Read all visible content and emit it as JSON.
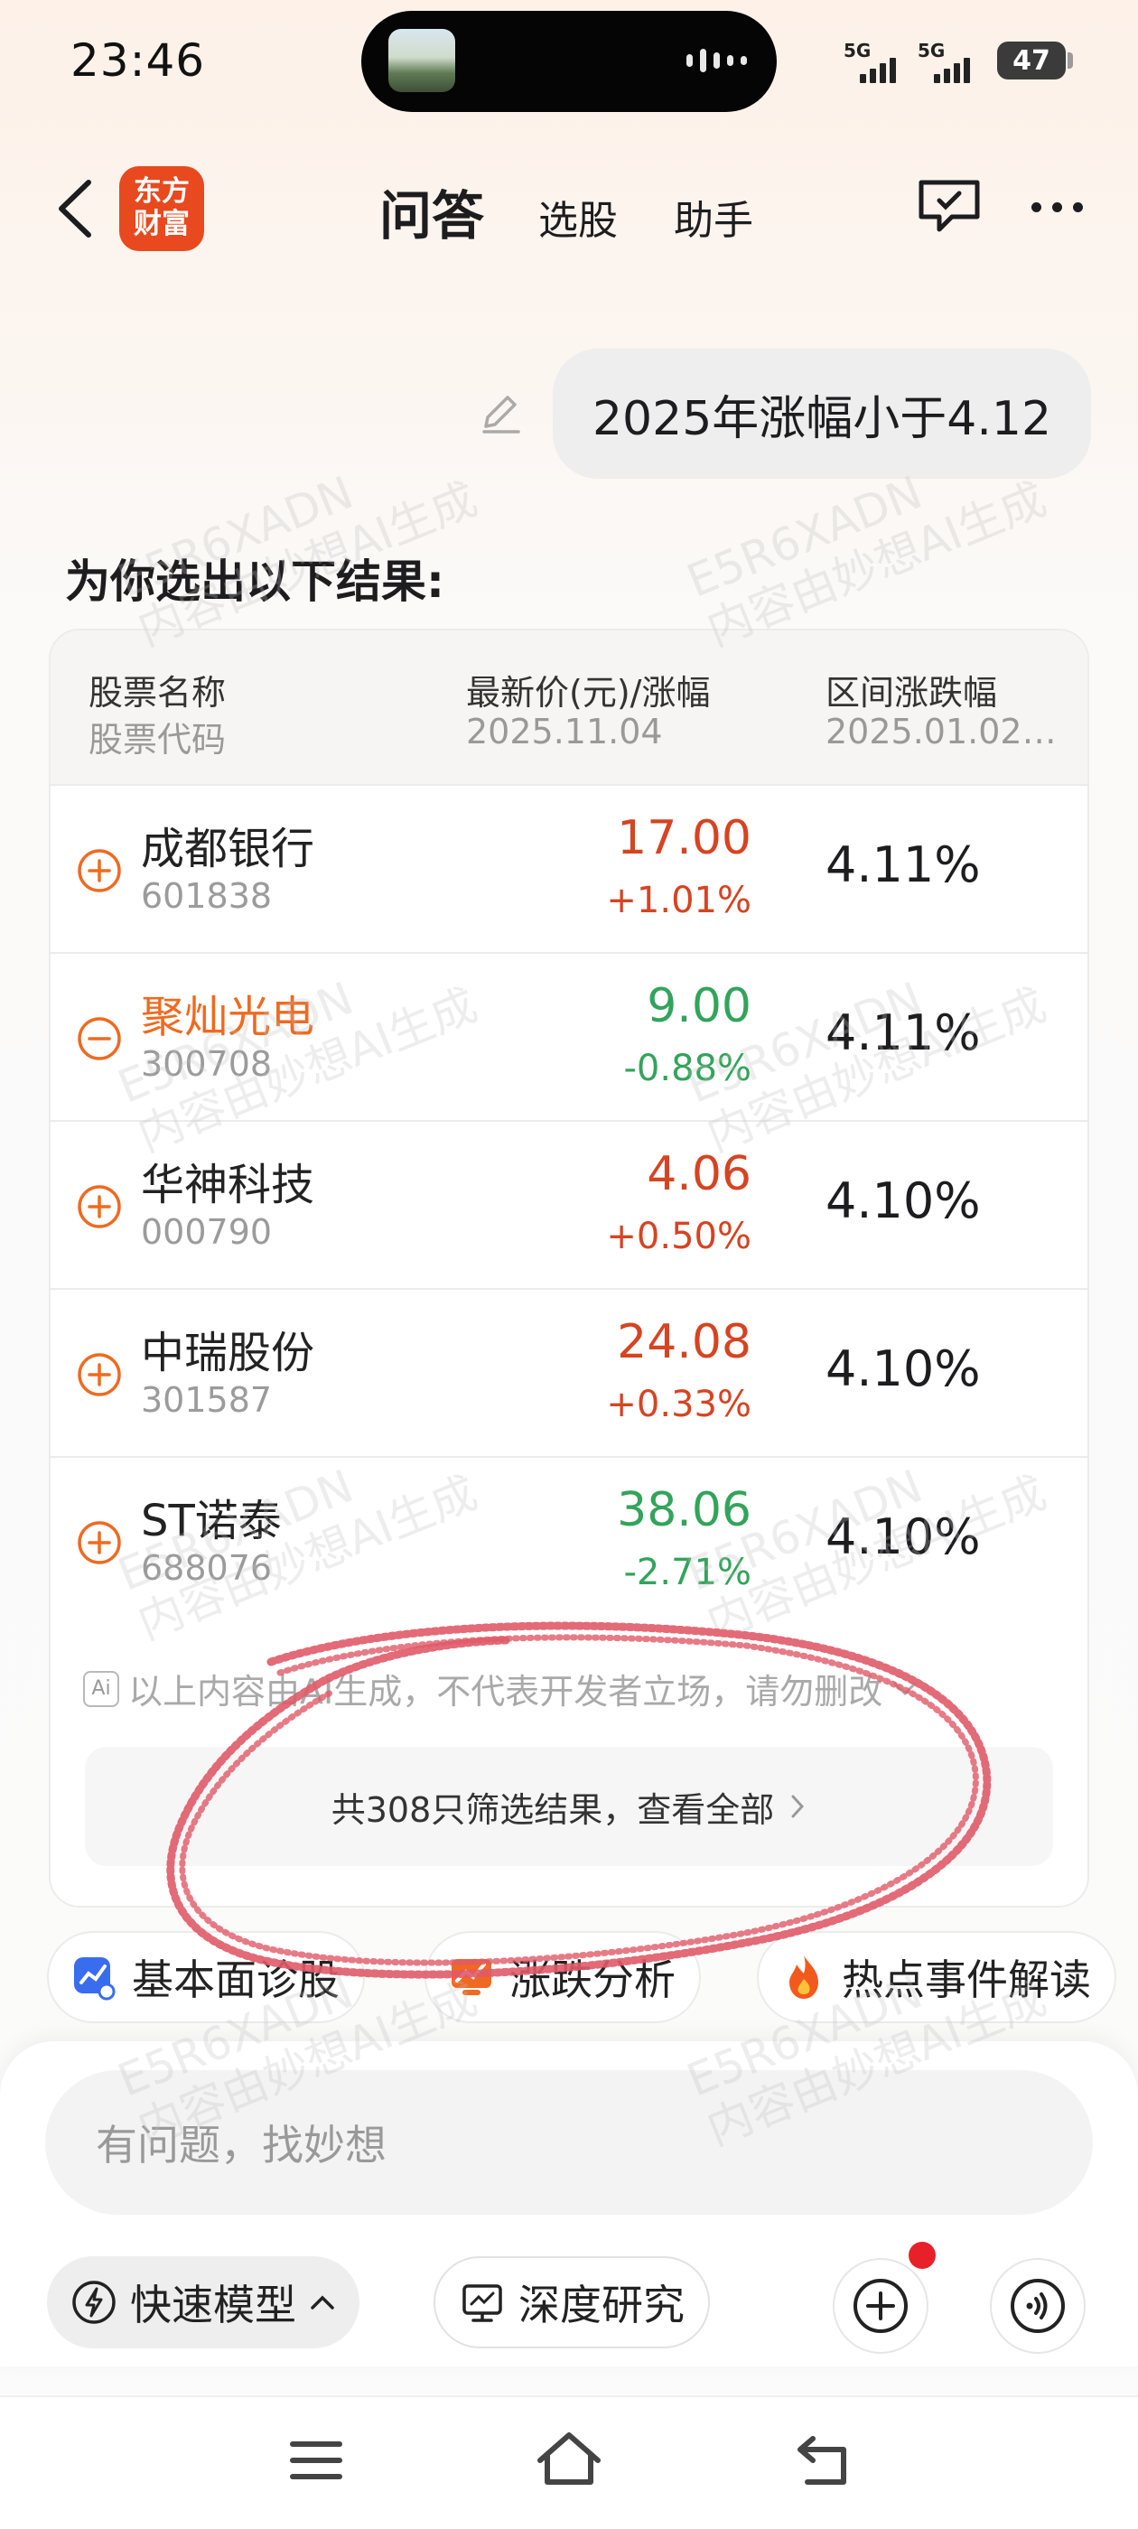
{
  "status_bar": {
    "time": "23:46",
    "signal_1": "5G",
    "signal_2": "5G",
    "battery": "47"
  },
  "nav": {
    "logo_line1": "东方",
    "logo_line2": "财富",
    "tab_main": "问答",
    "tab_2": "选股",
    "tab_3": "助手"
  },
  "user_query": "2025年涨幅小于4.12",
  "result_title": "为你选出以下结果:",
  "table": {
    "headers": {
      "name": "股票名称",
      "code": "股票代码",
      "price": "最新价(元)/涨幅",
      "price_date": "2025.11.04",
      "range": "区间涨跌幅",
      "range_date": "2025.01.02…"
    },
    "rows": [
      {
        "name": "成都银行",
        "code": "601838",
        "price": "17.00",
        "change": "+1.01%",
        "range": "4.11%",
        "direction": "up",
        "action": "add"
      },
      {
        "name": "聚灿光电",
        "code": "300708",
        "price": "9.00",
        "change": "-0.88%",
        "range": "4.11%",
        "direction": "down",
        "action": "remove"
      },
      {
        "name": "华神科技",
        "code": "000790",
        "price": "4.06",
        "change": "+0.50%",
        "range": "4.10%",
        "direction": "up",
        "action": "add"
      },
      {
        "name": "中瑞股份",
        "code": "301587",
        "price": "24.08",
        "change": "+0.33%",
        "range": "4.10%",
        "direction": "up",
        "action": "add"
      },
      {
        "name": "ST诺泰",
        "code": "688076",
        "price": "38.06",
        "change": "-2.71%",
        "range": "4.10%",
        "direction": "down",
        "action": "add"
      }
    ],
    "ai_badge": "Ai",
    "disclaimer": "以上内容由AI生成，不代表开发者立场，请勿删改",
    "view_all": "共308只筛选结果，查看全部"
  },
  "chips": [
    "基本面诊股",
    "涨跌分析",
    "热点事件解读"
  ],
  "input": {
    "placeholder": "有问题，找妙想"
  },
  "modes": {
    "fast": "快速模型",
    "deep": "深度研究"
  },
  "watermark": {
    "line1": "E5R6XADN",
    "line2": "内容由妙想AI生成"
  },
  "colors": {
    "up": "#d64422",
    "down": "#32a45b",
    "accent": "#ef6a20",
    "annotation": "#e05a68"
  }
}
